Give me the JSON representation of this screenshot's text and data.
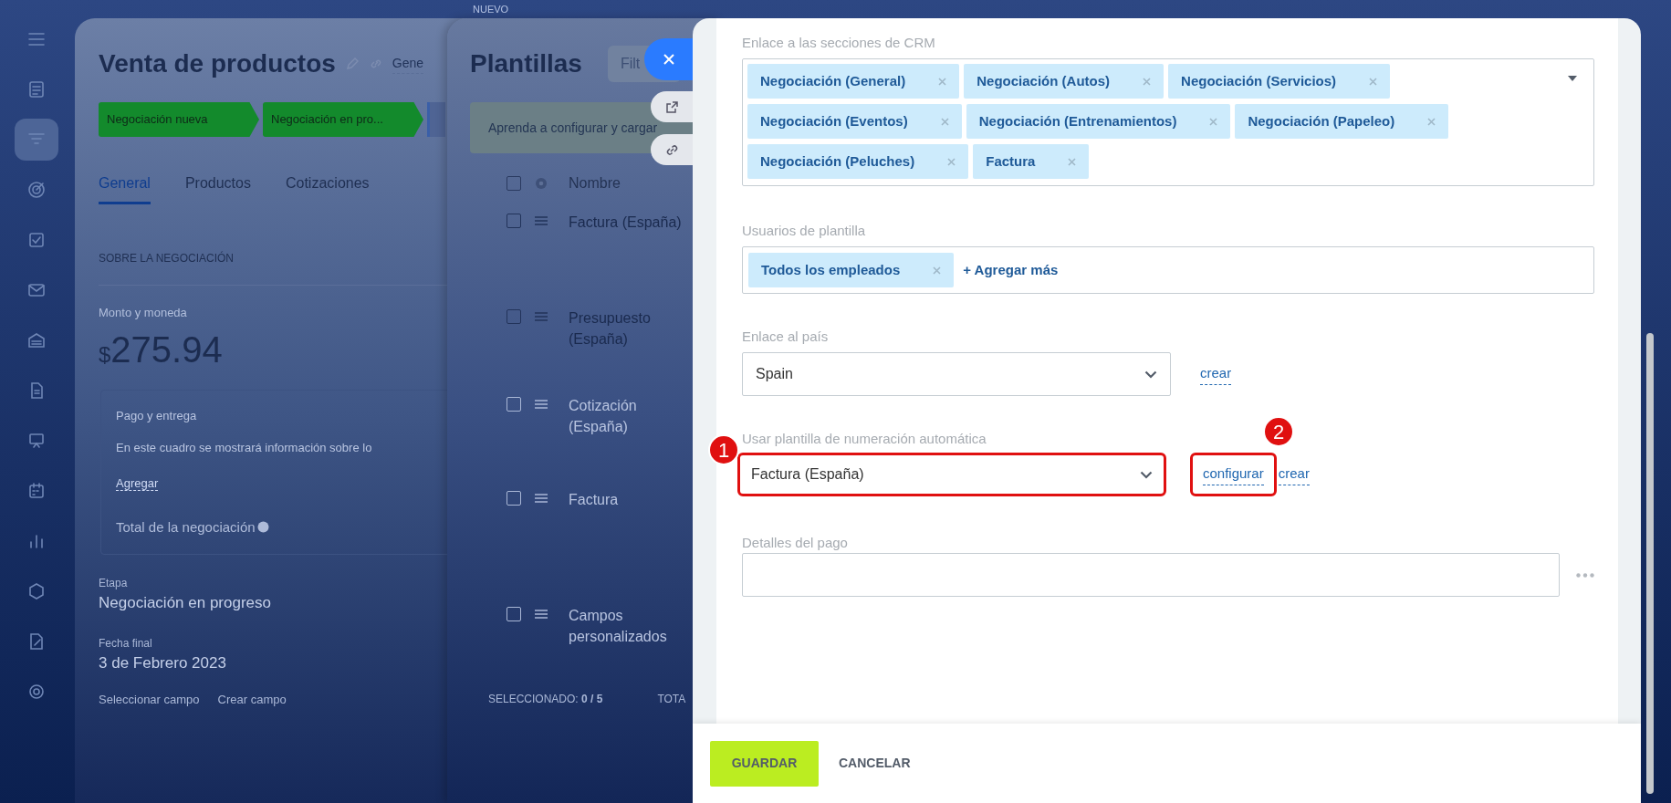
{
  "sidebar": {
    "items": [
      {
        "selected": false
      },
      {
        "selected": false
      },
      {
        "selected": true
      },
      {
        "selected": false
      },
      {
        "selected": false
      },
      {
        "selected": false
      },
      {
        "selected": false
      },
      {
        "selected": false
      },
      {
        "selected": false
      },
      {
        "selected": false
      },
      {
        "selected": false
      },
      {
        "selected": false
      },
      {
        "selected": false
      },
      {
        "selected": false
      }
    ]
  },
  "top_label": "NUEVO",
  "deal": {
    "title": "Venta de productos",
    "pipeline": "Gene",
    "stages": [
      {
        "label": "Negociación nueva",
        "color": "#138a2c"
      },
      {
        "label": "Negociación en pro...",
        "color": "#138a2c"
      }
    ],
    "tabs": [
      {
        "label": "General",
        "selected": true
      },
      {
        "label": "Productos",
        "selected": false
      },
      {
        "label": "Cotizaciones",
        "selected": false
      }
    ],
    "section_title": "SOBRE LA NEGOCIACIÓN",
    "amount_label": "Monto y moneda",
    "currency": "$",
    "amount": "275.94",
    "payment": {
      "title": "Pago y entrega",
      "text": "En este cuadro se mostrará información sobre lo",
      "link": "Agregar"
    },
    "total_label": "Total de la negociación",
    "fields": [
      {
        "label": "Etapa",
        "value": "Negociación en progreso"
      },
      {
        "label": "Fecha final",
        "value": "3 de Febrero 2023"
      }
    ],
    "links": [
      "Seleccionar campo",
      "Crear campo"
    ]
  },
  "templates": {
    "title": "Plantillas",
    "search": {
      "placeholder": "Filt"
    },
    "banner": "Aprenda a configurar y cargar",
    "column": "Nombre",
    "header_checked": false,
    "rows": [
      {
        "name": "Factura (España)",
        "checked": false
      },
      {
        "name": "Presupuesto (España)",
        "checked": false
      },
      {
        "name": "Cotización (España)",
        "checked": false
      },
      {
        "name": "Factura",
        "checked": false
      },
      {
        "name": "Campos personalizados",
        "checked": false
      }
    ],
    "footer": {
      "selected_label": "SELECCIONADO:",
      "selected_value": "0 / 5",
      "total": "TOTA"
    }
  },
  "form": {
    "crm_sections": {
      "label": "Enlace a las secciones de CRM",
      "tags": [
        "Negociación (General)",
        "Negociación (Autos)",
        "Negociación (Servicios)",
        "Negociación (Eventos)",
        "Negociación (Entrenamientos)",
        "Negociación (Papeleo)",
        "Negociación (Peluches)",
        "Factura"
      ]
    },
    "users": {
      "label": "Usuarios de plantilla",
      "tags": [
        "Todos los empleados"
      ],
      "add": "+ Agregar más"
    },
    "country": {
      "label": "Enlace al país",
      "value": "Spain",
      "link": "crear"
    },
    "numbering": {
      "label": "Usar plantilla de numeración automática",
      "value": "Factura (España)",
      "links": [
        "configurar",
        "crear"
      ]
    },
    "payment_details": {
      "label": "Detalles del pago"
    },
    "buttons": {
      "save": "GUARDAR",
      "cancel": "CANCELAR"
    }
  },
  "annotations": [
    {
      "label": "1"
    },
    {
      "label": "2"
    }
  ]
}
